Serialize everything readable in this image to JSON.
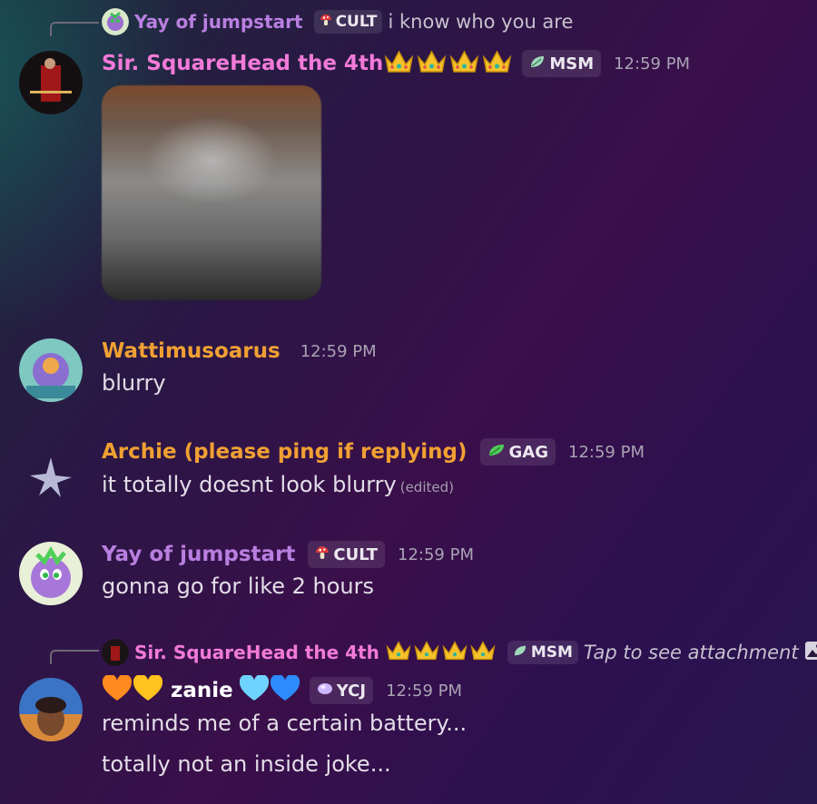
{
  "messages": [
    {
      "reply": {
        "author": "Yay of jumpstart",
        "tag": "CULT",
        "text": "i know who you are"
      },
      "author": "Sir. SquareHead the 4th",
      "tag": "MSM",
      "time": "12:59 PM",
      "attachment": "blurred-image"
    },
    {
      "author": "Wattimusoarus",
      "time": "12:59 PM",
      "text": "blurry"
    },
    {
      "author": "Archie (please ping if replying)",
      "tag": "GAG",
      "time": "12:59 PM",
      "text": "it totally doesnt look blurry",
      "edited": "(edited)"
    },
    {
      "author": "Yay of jumpstart",
      "tag": "CULT",
      "time": "12:59 PM",
      "text": "gonna go for like 2 hours"
    },
    {
      "reply": {
        "author": "Sir. SquareHead the 4th",
        "tag": "MSM",
        "text": "Tap to see attachment"
      },
      "author": "zanie",
      "tag": "YCJ",
      "time": "12:59 PM",
      "text": "reminds me of a certain battery...",
      "text2": "totally not an inside joke..."
    }
  ],
  "colors": {
    "sir_name": "#f27ad8",
    "watti_name": "#f0a033",
    "archie_name": "#f0a033",
    "yay_name": "#b97fe0",
    "zanie_name": "#ffffff"
  },
  "icons": {
    "crown": "crown-emoji",
    "cult": "mushroom-icon",
    "msm": "leaf-icon",
    "gag": "leaf-icon",
    "ycj": "gem-icon",
    "attachment": "image-icon"
  }
}
